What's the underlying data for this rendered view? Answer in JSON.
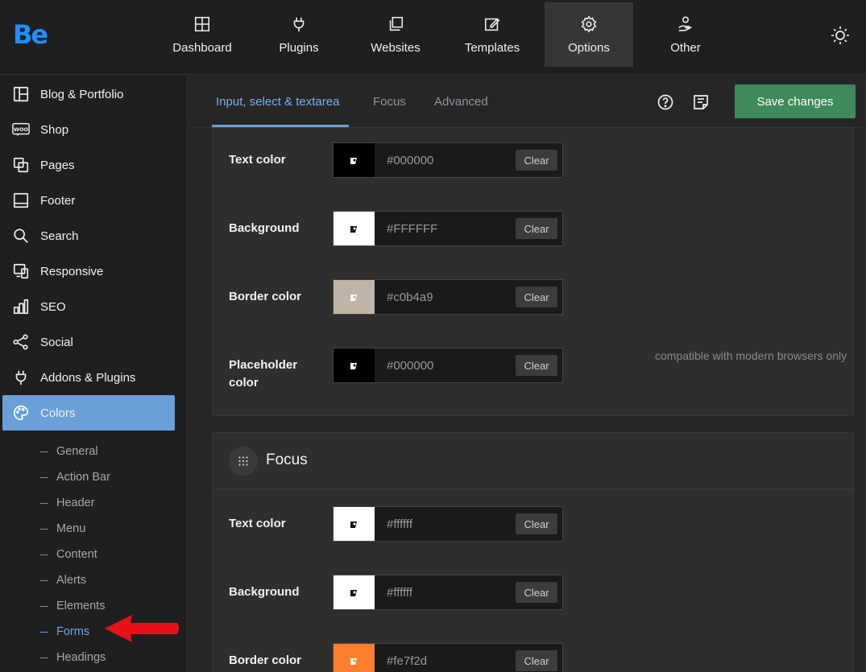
{
  "app": {
    "logo": "Be"
  },
  "topnav": [
    {
      "label": "Dashboard",
      "icon": "dashboard-icon"
    },
    {
      "label": "Plugins",
      "icon": "plug-icon"
    },
    {
      "label": "Websites",
      "icon": "websites-icon"
    },
    {
      "label": "Templates",
      "icon": "templates-icon"
    },
    {
      "label": "Options",
      "icon": "gear-icon",
      "active": true
    },
    {
      "label": "Other",
      "icon": "hand-user-icon"
    }
  ],
  "sidebar": {
    "items": [
      {
        "label": "Blog & Portfolio",
        "icon": "layout-icon"
      },
      {
        "label": "Shop",
        "icon": "woo-icon"
      },
      {
        "label": "Pages",
        "icon": "pages-icon"
      },
      {
        "label": "Footer",
        "icon": "footer-icon"
      },
      {
        "label": "Search",
        "icon": "search-icon"
      },
      {
        "label": "Responsive",
        "icon": "responsive-icon"
      },
      {
        "label": "SEO",
        "icon": "seo-icon"
      },
      {
        "label": "Social",
        "icon": "share-icon"
      },
      {
        "label": "Addons & Plugins",
        "icon": "plug-icon"
      },
      {
        "label": "Colors",
        "icon": "palette-icon",
        "active": true
      }
    ],
    "subitems": [
      {
        "label": "General"
      },
      {
        "label": "Action Bar"
      },
      {
        "label": "Header"
      },
      {
        "label": "Menu"
      },
      {
        "label": "Content"
      },
      {
        "label": "Alerts"
      },
      {
        "label": "Elements"
      },
      {
        "label": "Forms",
        "active": true
      },
      {
        "label": "Headings"
      }
    ]
  },
  "tabs": [
    {
      "label": "Input, select & textarea",
      "active": true
    },
    {
      "label": "Focus"
    },
    {
      "label": "Advanced"
    }
  ],
  "toolbar": {
    "save_label": "Save changes",
    "help_icon": "help-icon",
    "notes_icon": "notes-icon"
  },
  "default_section": {
    "rows": [
      {
        "label": "Text color",
        "swatch": "#000000",
        "value": "#000000",
        "clear": "Clear"
      },
      {
        "label": "Background",
        "swatch": "#FFFFFF",
        "value": "#FFFFFF",
        "clear": "Clear"
      },
      {
        "label": "Border color",
        "swatch": "#c0b4a9",
        "value": "#c0b4a9",
        "clear": "Clear"
      },
      {
        "label": "Placeholder color",
        "swatch": "#000000",
        "value": "#000000",
        "clear": "Clear",
        "note": "compatible with modern browsers only"
      }
    ]
  },
  "focus_section": {
    "title": "Focus",
    "rows": [
      {
        "label": "Text color",
        "swatch": "#ffffff",
        "value": "#ffffff",
        "clear": "Clear"
      },
      {
        "label": "Background",
        "swatch": "#ffffff",
        "value": "#ffffff",
        "clear": "Clear"
      },
      {
        "label": "Border color",
        "swatch": "#fe7f2d",
        "value": "#fe7f2d",
        "clear": "Clear"
      }
    ]
  },
  "colors": {
    "accent": "#6a9fd8",
    "save": "#3e8a5b",
    "annotation_arrow": "#e8101a"
  }
}
